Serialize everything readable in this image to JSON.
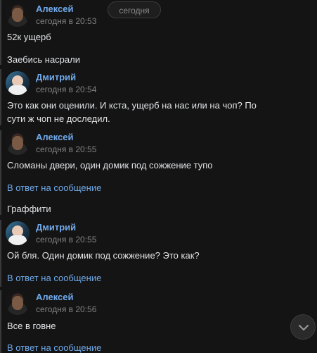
{
  "date_divider": "сегодня",
  "messages": [
    {
      "author": "Алексей",
      "time": "сегодня в 20:53",
      "texts": [
        "52к ущерб",
        "Заебись насрали"
      ]
    },
    {
      "author": "Дмитрий",
      "time": "сегодня в 20:54",
      "texts": [
        "Это как они оценили. И кста, ущерб на нас или на чоп? По сути ж чоп не доследил."
      ]
    },
    {
      "author": "Алексей",
      "time": "сегодня в 20:55",
      "texts": [
        "Сломаны двери, один домик под сожжение тупо",
        "Граффити"
      ],
      "reply_link": "В ответ на сообщение"
    },
    {
      "author": "Дмитрий",
      "time": "сегодня в 20:55",
      "texts": [
        "Ой бля. Один домик под сожжение? Это как?"
      ],
      "reply_link": "В ответ на сообщение"
    },
    {
      "author": "Алексей",
      "time": "сегодня в 20:56",
      "texts": [
        "Все в говне"
      ],
      "reply_link": "В ответ на сообщение"
    }
  ],
  "icons": {
    "scroll_down": "chevron-down-icon"
  },
  "colors": {
    "accent": "#71aaeb",
    "background": "#141414",
    "text": "#e1e3e6",
    "muted": "#828282"
  }
}
